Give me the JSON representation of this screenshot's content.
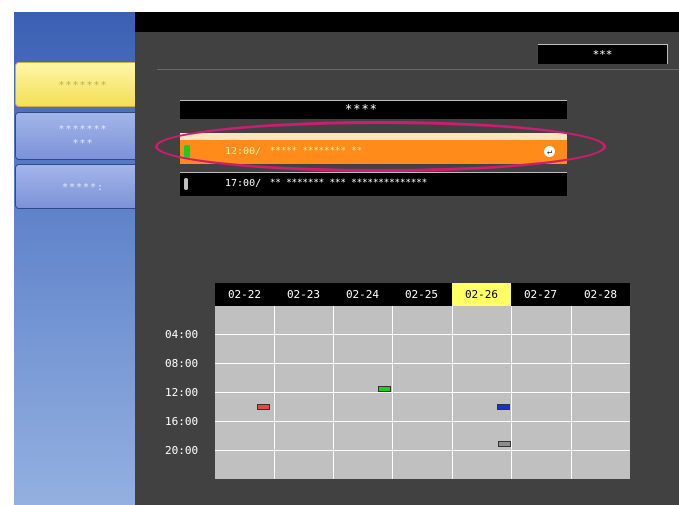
{
  "sidebar": {
    "items": [
      {
        "label": "*******",
        "state": "active"
      },
      {
        "label": "*******\n***",
        "state": "normal"
      },
      {
        "label": "*****:",
        "state": "normal"
      }
    ]
  },
  "header": {
    "button_label": "***"
  },
  "schedule_list": {
    "title": "****",
    "rows": [
      {
        "time": "12:00/",
        "description": "***** ******** **",
        "marker_color": "#22c722",
        "selected": true
      },
      {
        "time": "17:00/",
        "description": "** ******* *** **************",
        "marker_color": "#bfbfbf",
        "selected": false
      }
    ]
  },
  "calendar": {
    "days": [
      "02-22",
      "02-23",
      "02-24",
      "02-25",
      "02-26",
      "02-27",
      "02-28"
    ],
    "today": "02-26",
    "time_labels": [
      "04:00",
      "08:00",
      "12:00",
      "16:00",
      "20:00"
    ],
    "events": [
      {
        "day": "02-22",
        "hour": 13,
        "color": "#e84545"
      },
      {
        "day": "02-24",
        "hour": 10,
        "color": "#22cc22"
      },
      {
        "day": "02-26",
        "hour": 13,
        "color": "#1a2fd4"
      },
      {
        "day": "02-26",
        "hour": 17,
        "color": "#8c8c8c"
      }
    ]
  },
  "colors": {
    "accent_selected_row": "#ff8c1a",
    "today_highlight": "#ffff66",
    "annotation_ellipse": "#d01b72"
  }
}
